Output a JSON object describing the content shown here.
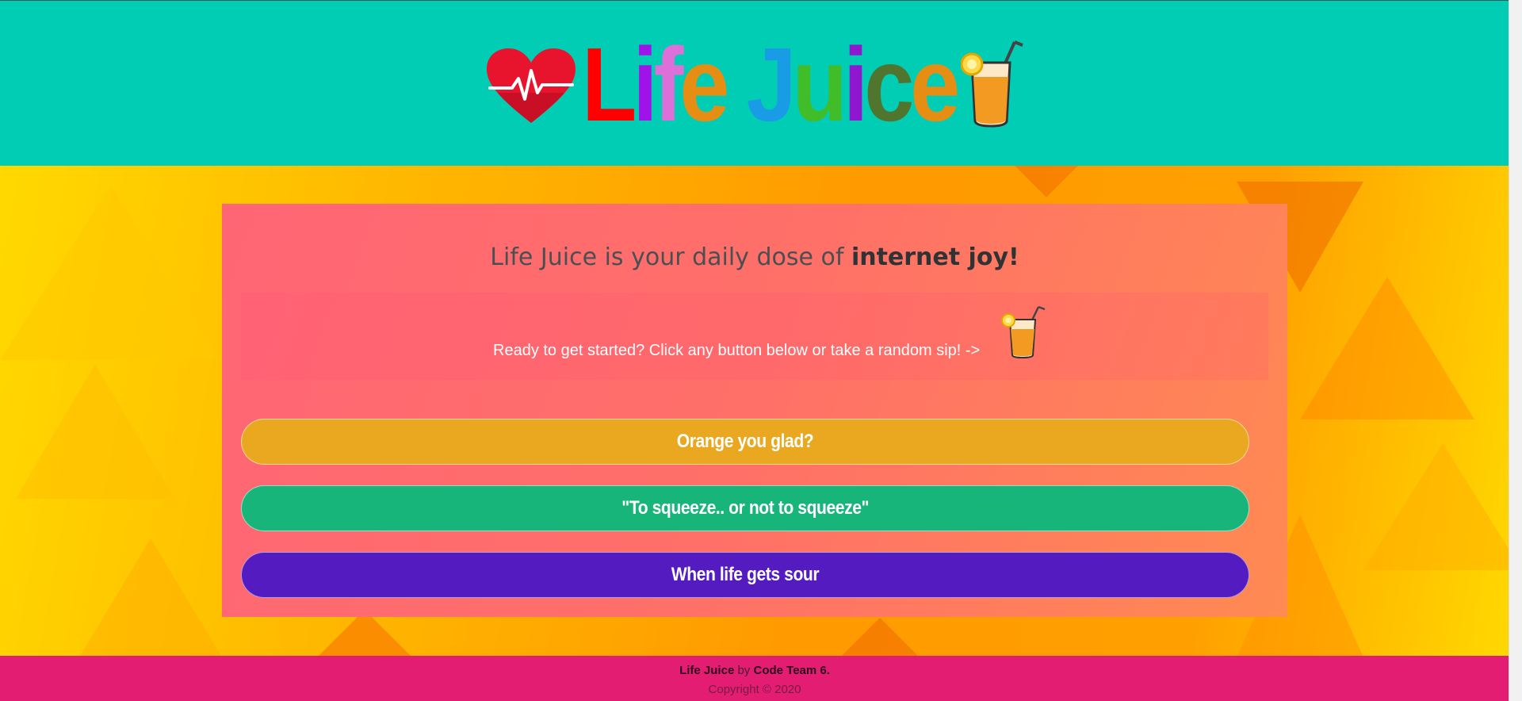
{
  "header": {
    "logo_letters": [
      {
        "char": "L",
        "color": "#ff0000"
      },
      {
        "char": "i",
        "color": "#a013e8"
      },
      {
        "char": "f",
        "color": "#dd6fd8"
      },
      {
        "char": "e",
        "color": "#e68d14"
      },
      {
        "char": " ",
        "color": "#000000"
      },
      {
        "char": "J",
        "color": "#1a9be6"
      },
      {
        "char": "u",
        "color": "#42bd2a"
      },
      {
        "char": "i",
        "color": "#8f17d0"
      },
      {
        "char": "c",
        "color": "#50752f"
      },
      {
        "char": "e",
        "color": "#e68d14"
      }
    ],
    "logo_icons": [
      "heartbeat-heart-icon",
      "juice-glass-icon"
    ]
  },
  "main": {
    "headline_prefix": "Life Juice is your daily dose of ",
    "headline_bold": "internet joy!",
    "prompt": "Ready to get started? Click any button below or take a random sip! ->",
    "random_sip_icon": "juice-glass-icon",
    "buttons": [
      {
        "label": "Orange you glad?",
        "color": "#eaa820"
      },
      {
        "label": "\"To squeeze.. or not to squeeze\"",
        "color": "#17b57a"
      },
      {
        "label": "When life gets sour",
        "color": "#531bc0"
      }
    ]
  },
  "footer": {
    "brand": "Life Juice",
    "by": " by ",
    "team": "Code Team 6.",
    "copyright": "Copyright © 2020"
  },
  "colors": {
    "header_bg": "#00cdb4",
    "footer_bg": "#e31d72",
    "card_bg": "#ff6d6d"
  }
}
